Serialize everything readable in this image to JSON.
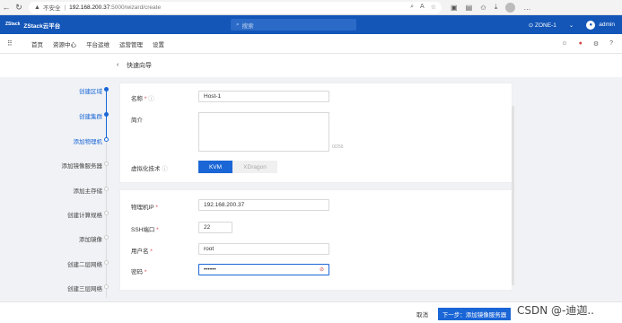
{
  "browser": {
    "insecure_label": "不安全",
    "url_host": "192.168.200.37",
    "url_path": ":5000/wizard/create"
  },
  "header": {
    "logo_text": "ZStack云平台",
    "logo_mark": "ZStack",
    "search_placeholder": "搜索",
    "zone": "ZONE-1",
    "user": "admin"
  },
  "nav": {
    "items": [
      "首页",
      "资源中心",
      "平台运维",
      "运营管理",
      "设置"
    ]
  },
  "page": {
    "title": "快速向导"
  },
  "steps": [
    {
      "label": "创建区域",
      "state": "done"
    },
    {
      "label": "创建集群",
      "state": "done"
    },
    {
      "label": "添加物理机",
      "state": "current"
    },
    {
      "label": "添加镜像服务器",
      "state": "todo"
    },
    {
      "label": "添加主存储",
      "state": "todo"
    },
    {
      "label": "创建计算规格",
      "state": "todo"
    },
    {
      "label": "添加镜像",
      "state": "todo"
    },
    {
      "label": "创建二层网络",
      "state": "todo"
    },
    {
      "label": "创建三层网络",
      "state": "todo"
    }
  ],
  "form": {
    "name_label": "名称",
    "name_value": "Host-1",
    "desc_label": "简介",
    "desc_counter": "0/256",
    "virt_label": "虚拟化技术",
    "virt_options": [
      "KVM",
      "XDragon"
    ],
    "virt_selected": "KVM",
    "ip_label": "物理机IP",
    "ip_value": "192.168.200.37",
    "ssh_label": "SSH端口",
    "ssh_value": "22",
    "user_label": "用户名",
    "user_value": "root",
    "pwd_label": "密码",
    "pwd_value": "••••••"
  },
  "footer": {
    "cancel": "取消",
    "next": "下一步：添加镜像服务器",
    "watermark": "CSDN @-迪迦.."
  },
  "colors": {
    "brand": "#1356b8",
    "accent": "#1a66d6",
    "required": "#e54545"
  }
}
